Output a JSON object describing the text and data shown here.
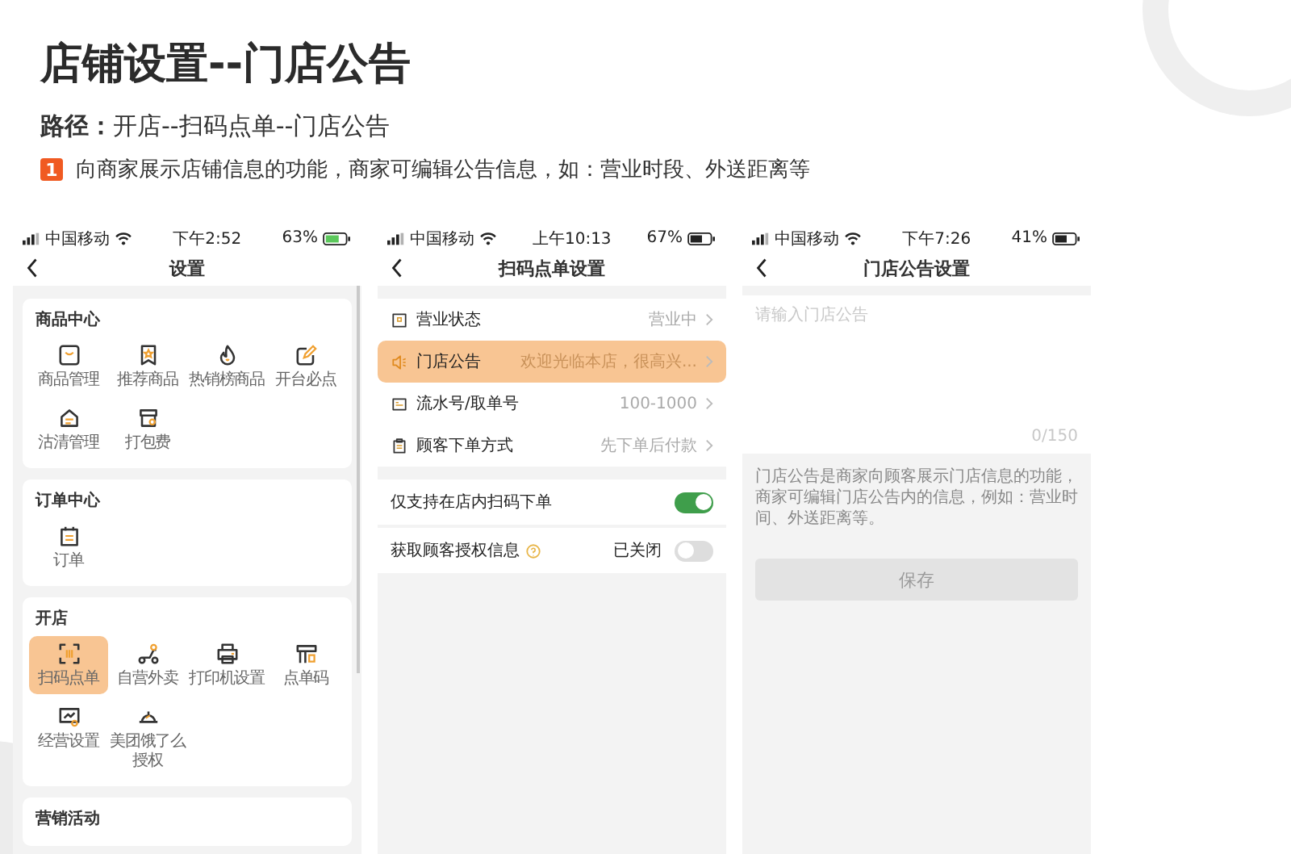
{
  "header": {
    "title": "店铺设置--门店公告",
    "path": "**路径：**开店--扫码点单--门店公告",
    "note": {
      "number": "1",
      "text": "向商家展示店铺信息的功能，商家可编辑公告信息，如：营业时段、外送距离等"
    }
  },
  "phones": [
    {
      "kind": "menu_grid",
      "status_bar": {
        "carrier": "中国移动",
        "time": "下午2:52",
        "battery": "63%"
      },
      "nav_title": "设置",
      "sections": [
        {
          "title": "商品中心",
          "items": [
            {
              "label": "商品管理",
              "selected": false
            },
            {
              "label": "推荐商品",
              "selected": false
            },
            {
              "label": "热销榜商品",
              "selected": false
            },
            {
              "label": "开台必点",
              "selected": false
            },
            {
              "label": "沽清管理",
              "selected": false
            },
            {
              "label": "打包费",
              "selected": false
            }
          ]
        },
        {
          "title": "订单中心",
          "items": [
            {
              "label": "订单",
              "selected": false
            }
          ]
        },
        {
          "title": "开店",
          "items": [
            {
              "label": "扫码点单",
              "selected": true
            },
            {
              "label": "自营外卖",
              "selected": false
            },
            {
              "label": "打印机设置",
              "selected": false
            },
            {
              "label": "点单码",
              "selected": false
            },
            {
              "label": "经营设置",
              "selected": false
            },
            {
              "label": "美团饿了么授权",
              "selected": false
            }
          ]
        },
        {
          "title": "营销活动"
        }
      ]
    },
    {
      "kind": "settings_list",
      "status_bar": {
        "carrier": "中国移动",
        "time": "上午10:13",
        "battery": "67%"
      },
      "nav_title": "扫码点单设置",
      "rows": [
        {
          "label": "营业状态",
          "value": "营业中",
          "selected": false
        },
        {
          "label": "门店公告",
          "value": "欢迎光临本店，很高兴...",
          "selected": true
        },
        {
          "label": "流水号/取单号",
          "value": "100-1000",
          "selected": false
        },
        {
          "label": "顾客下单方式",
          "value": "先下单后付款",
          "selected": false
        }
      ],
      "toggles": [
        {
          "label": "仅支持在店内扫码下单",
          "on": true,
          "help": false
        },
        {
          "label": "获取顾客授权信息",
          "state_text": "已关闭",
          "on": false,
          "help": true
        }
      ]
    },
    {
      "kind": "notice_editor",
      "status_bar": {
        "carrier": "中国移动",
        "time": "下午7:26",
        "battery": "41%"
      },
      "nav_title": "门店公告设置",
      "placeholder": "请输入门店公告",
      "counter": "0/150",
      "description": "门店公告是商家向顾客展示门店信息的功能，商家可编辑门店公告内的信息，例如：营业时间、外送距离等。",
      "button": {
        "label": "保存",
        "disabled": true
      }
    }
  ]
}
